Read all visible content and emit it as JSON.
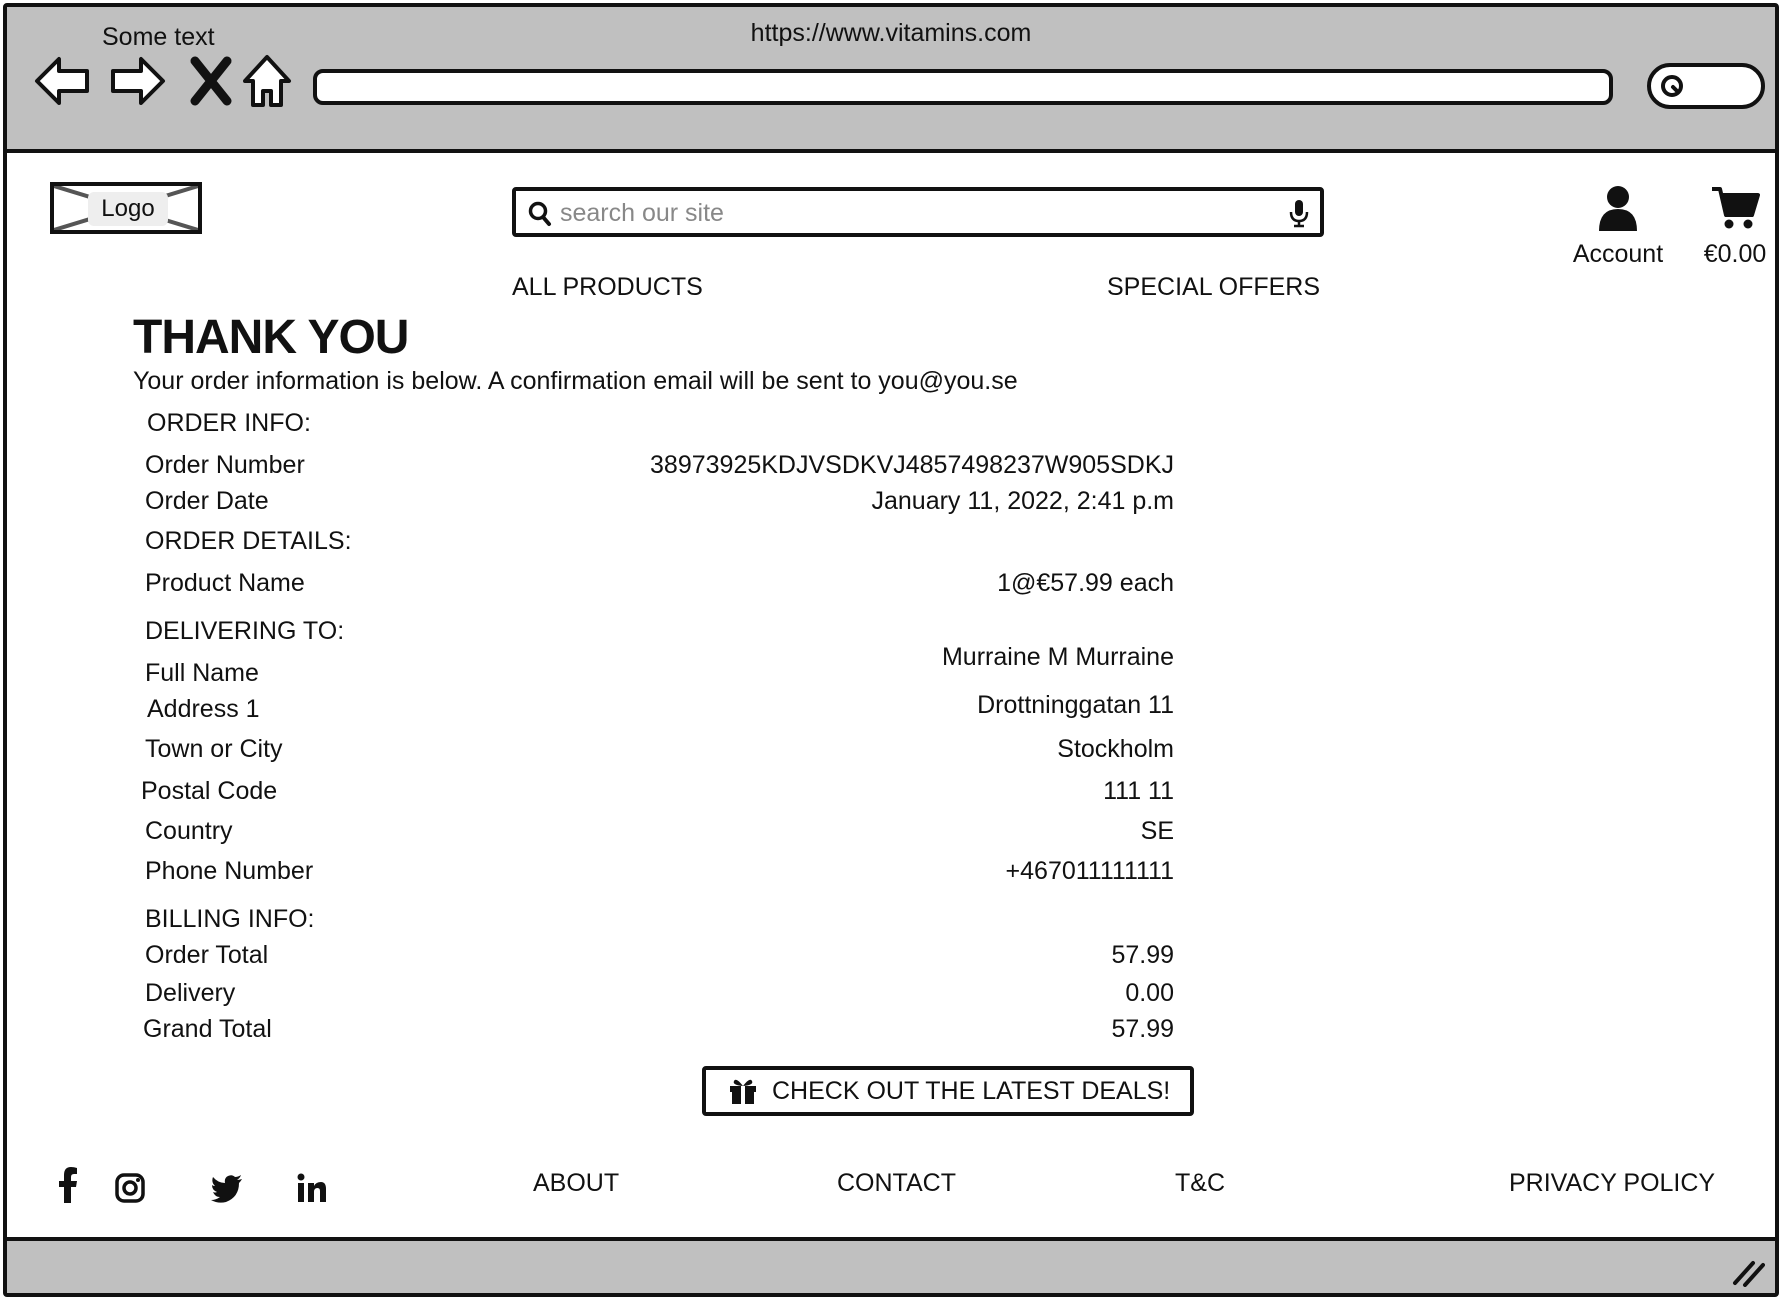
{
  "browser": {
    "title": "Some text",
    "url": "https://www.vitamins.com"
  },
  "header": {
    "logo_label": "Logo",
    "search_placeholder": "search our site",
    "account_label": "Account",
    "cart_total": "€0.00"
  },
  "nav": {
    "all_products": "ALL PRODUCTS",
    "special_offers": "SPECIAL OFFERS"
  },
  "confirmation": {
    "title": "THANK YOU",
    "subtitle": "Your order information is below. A confirmation email will be sent to you@you.se"
  },
  "order_info": {
    "heading": "ORDER INFO:",
    "rows": [
      {
        "label": "Order Number",
        "value": "38973925KDJVSDKVJ4857498237W905SDKJ"
      },
      {
        "label": "Order Date",
        "value": "January 11, 2022, 2:41 p.m"
      }
    ]
  },
  "order_details": {
    "heading": "ORDER DETAILS:",
    "rows": [
      {
        "label": "Product Name",
        "value": "1@€57.99 each"
      }
    ]
  },
  "delivering_to": {
    "heading": "DELIVERING TO:",
    "rows": [
      {
        "label": "Full Name",
        "value": "Murraine M Murraine"
      },
      {
        "label": "Address 1",
        "value": "Drottninggatan 11"
      },
      {
        "label": "Town or City",
        "value": "Stockholm"
      },
      {
        "label": "Postal Code",
        "value": "111 11"
      },
      {
        "label": "Country",
        "value": "SE"
      },
      {
        "label": "Phone Number",
        "value": "+467011111111"
      }
    ]
  },
  "billing_info": {
    "heading": "BILLING INFO:",
    "rows": [
      {
        "label": "Order Total",
        "value": "57.99"
      },
      {
        "label": "Delivery",
        "value": "0.00"
      },
      {
        "label": "Grand Total",
        "value": "57.99"
      }
    ]
  },
  "deals_button": {
    "label": "CHECK OUT THE LATEST DEALS!",
    "icon": "gift-icon"
  },
  "footer": {
    "social_icons": [
      "facebook-icon",
      "instagram-icon",
      "twitter-icon",
      "linkedin-icon"
    ],
    "links": {
      "about": "ABOUT",
      "contact": "CONTACT",
      "tc": "T&C",
      "privacy": "PRIVACY POLICY"
    }
  }
}
